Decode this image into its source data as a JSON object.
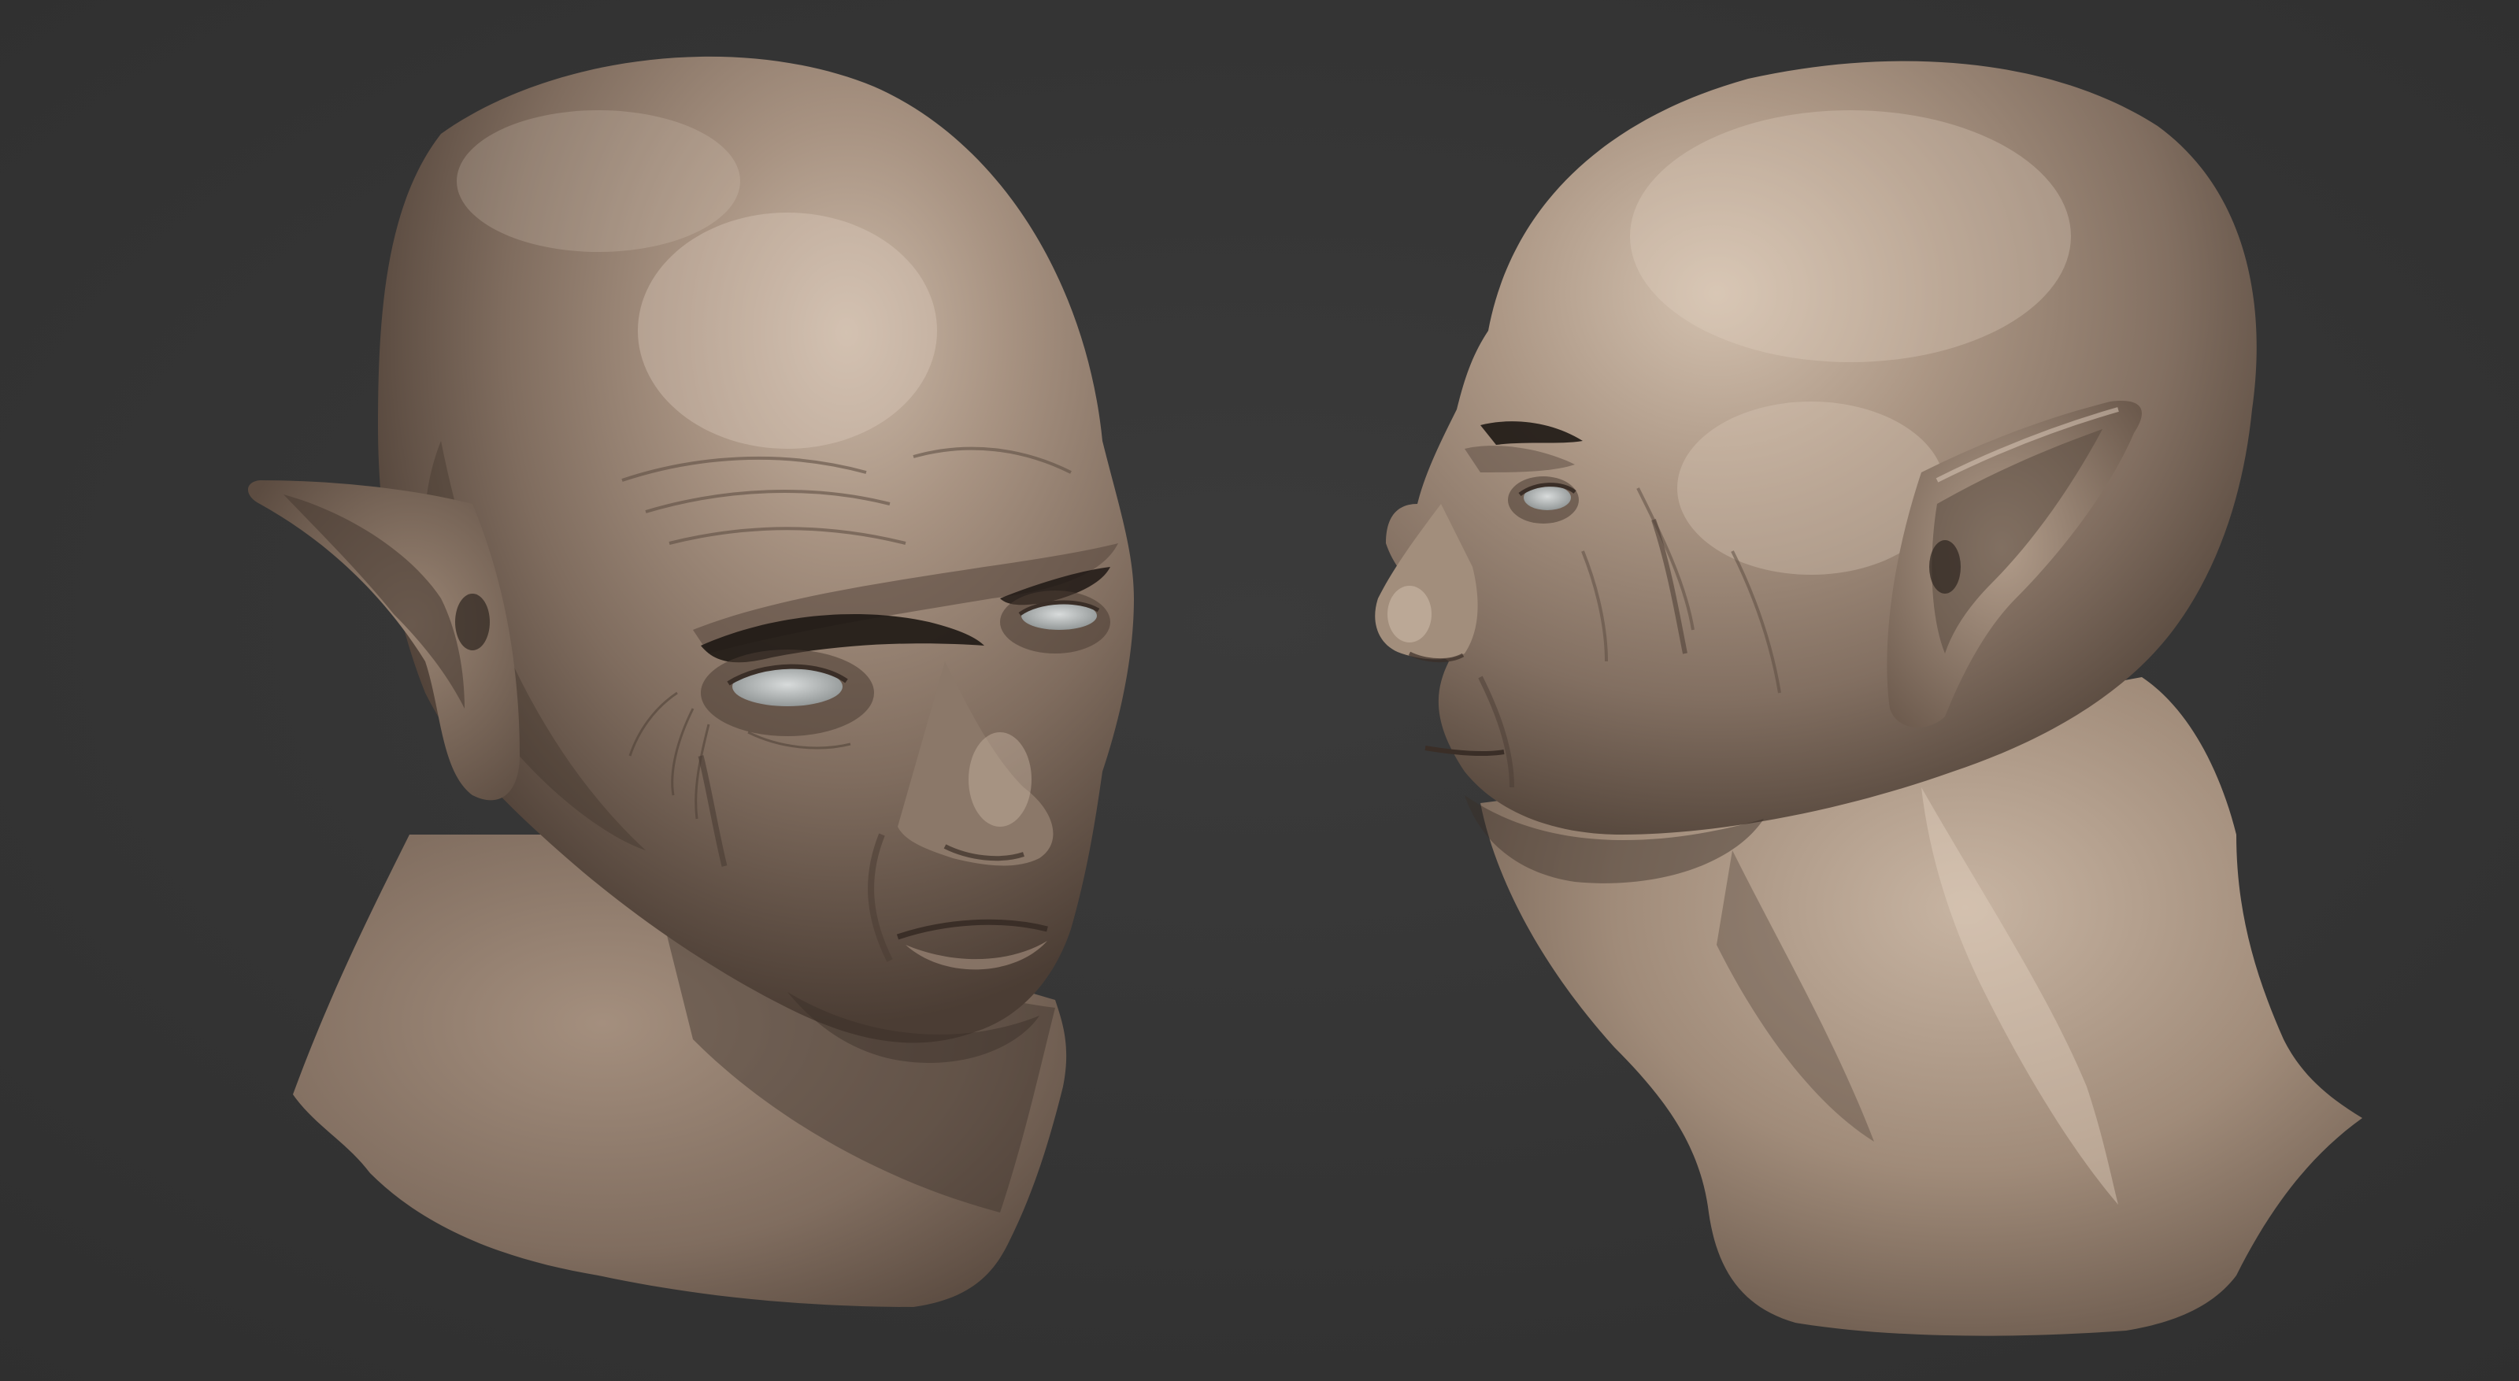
{
  "scene": {
    "background_color": "#353535",
    "clay_color": "#8a7868",
    "clay_highlight": "#c9b7a6",
    "clay_shadow": "#4a3c33",
    "eye_color": "#b9bcbc",
    "brow_color": "#1e1814"
  },
  "models": [
    {
      "name": "head-three-quarter-view"
    },
    {
      "name": "head-profile-view"
    }
  ]
}
